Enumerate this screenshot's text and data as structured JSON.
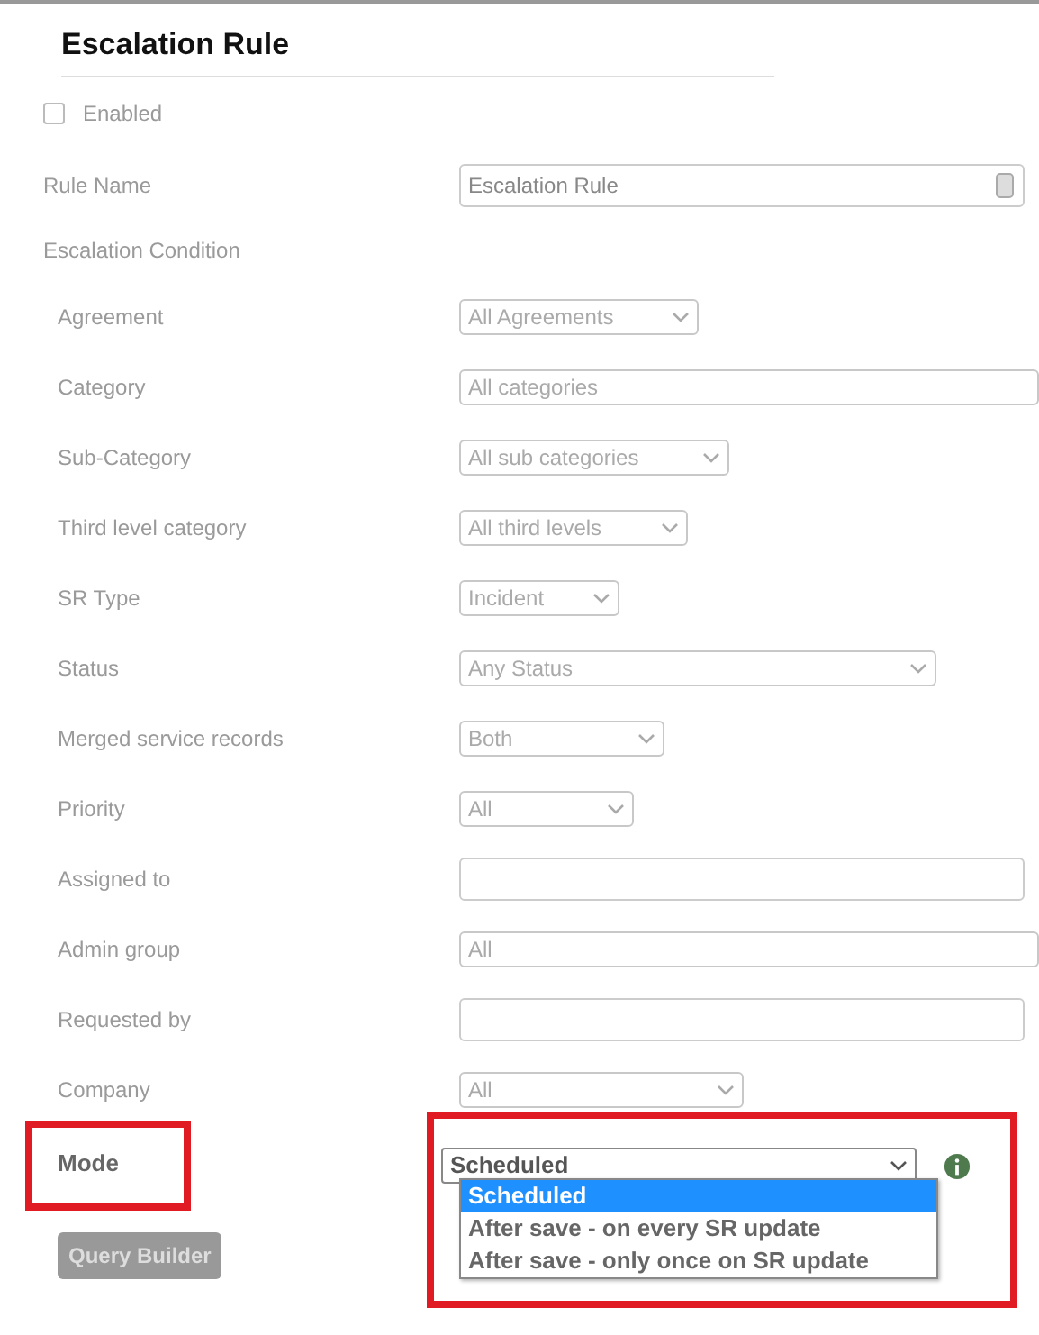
{
  "title": "Escalation Rule",
  "enabled": {
    "label": "Enabled",
    "checked": false
  },
  "rule_name": {
    "label": "Rule Name",
    "value": "Escalation Rule"
  },
  "condition_heading": "Escalation Condition",
  "conditions": [
    {
      "label": "Agreement",
      "kind": "select",
      "value": "All Agreements"
    },
    {
      "label": "Category",
      "kind": "select",
      "value": "All categories"
    },
    {
      "label": "Sub-Category",
      "kind": "select",
      "value": "All sub categories"
    },
    {
      "label": "Third level category",
      "kind": "select",
      "value": "All third levels"
    },
    {
      "label": "SR Type",
      "kind": "select",
      "value": "Incident"
    },
    {
      "label": "Status",
      "kind": "select",
      "value": "Any Status"
    },
    {
      "label": "Merged service records",
      "kind": "select",
      "value": "Both"
    },
    {
      "label": "Priority",
      "kind": "select",
      "value": "All"
    },
    {
      "label": "Assigned to",
      "kind": "text"
    },
    {
      "label": "Admin group",
      "kind": "select",
      "value": "All"
    },
    {
      "label": "Requested by",
      "kind": "text"
    },
    {
      "label": "Company",
      "kind": "select",
      "value": "All"
    }
  ],
  "mode": {
    "label": "Mode",
    "value": "Scheduled",
    "highlighted": true,
    "expanded": true,
    "options": [
      {
        "label": "Scheduled",
        "selected": true
      },
      {
        "label": "After save - on every SR update",
        "selected": false
      },
      {
        "label": "After save - only once on SR update",
        "selected": false
      }
    ]
  },
  "query_builder": "Query Builder"
}
